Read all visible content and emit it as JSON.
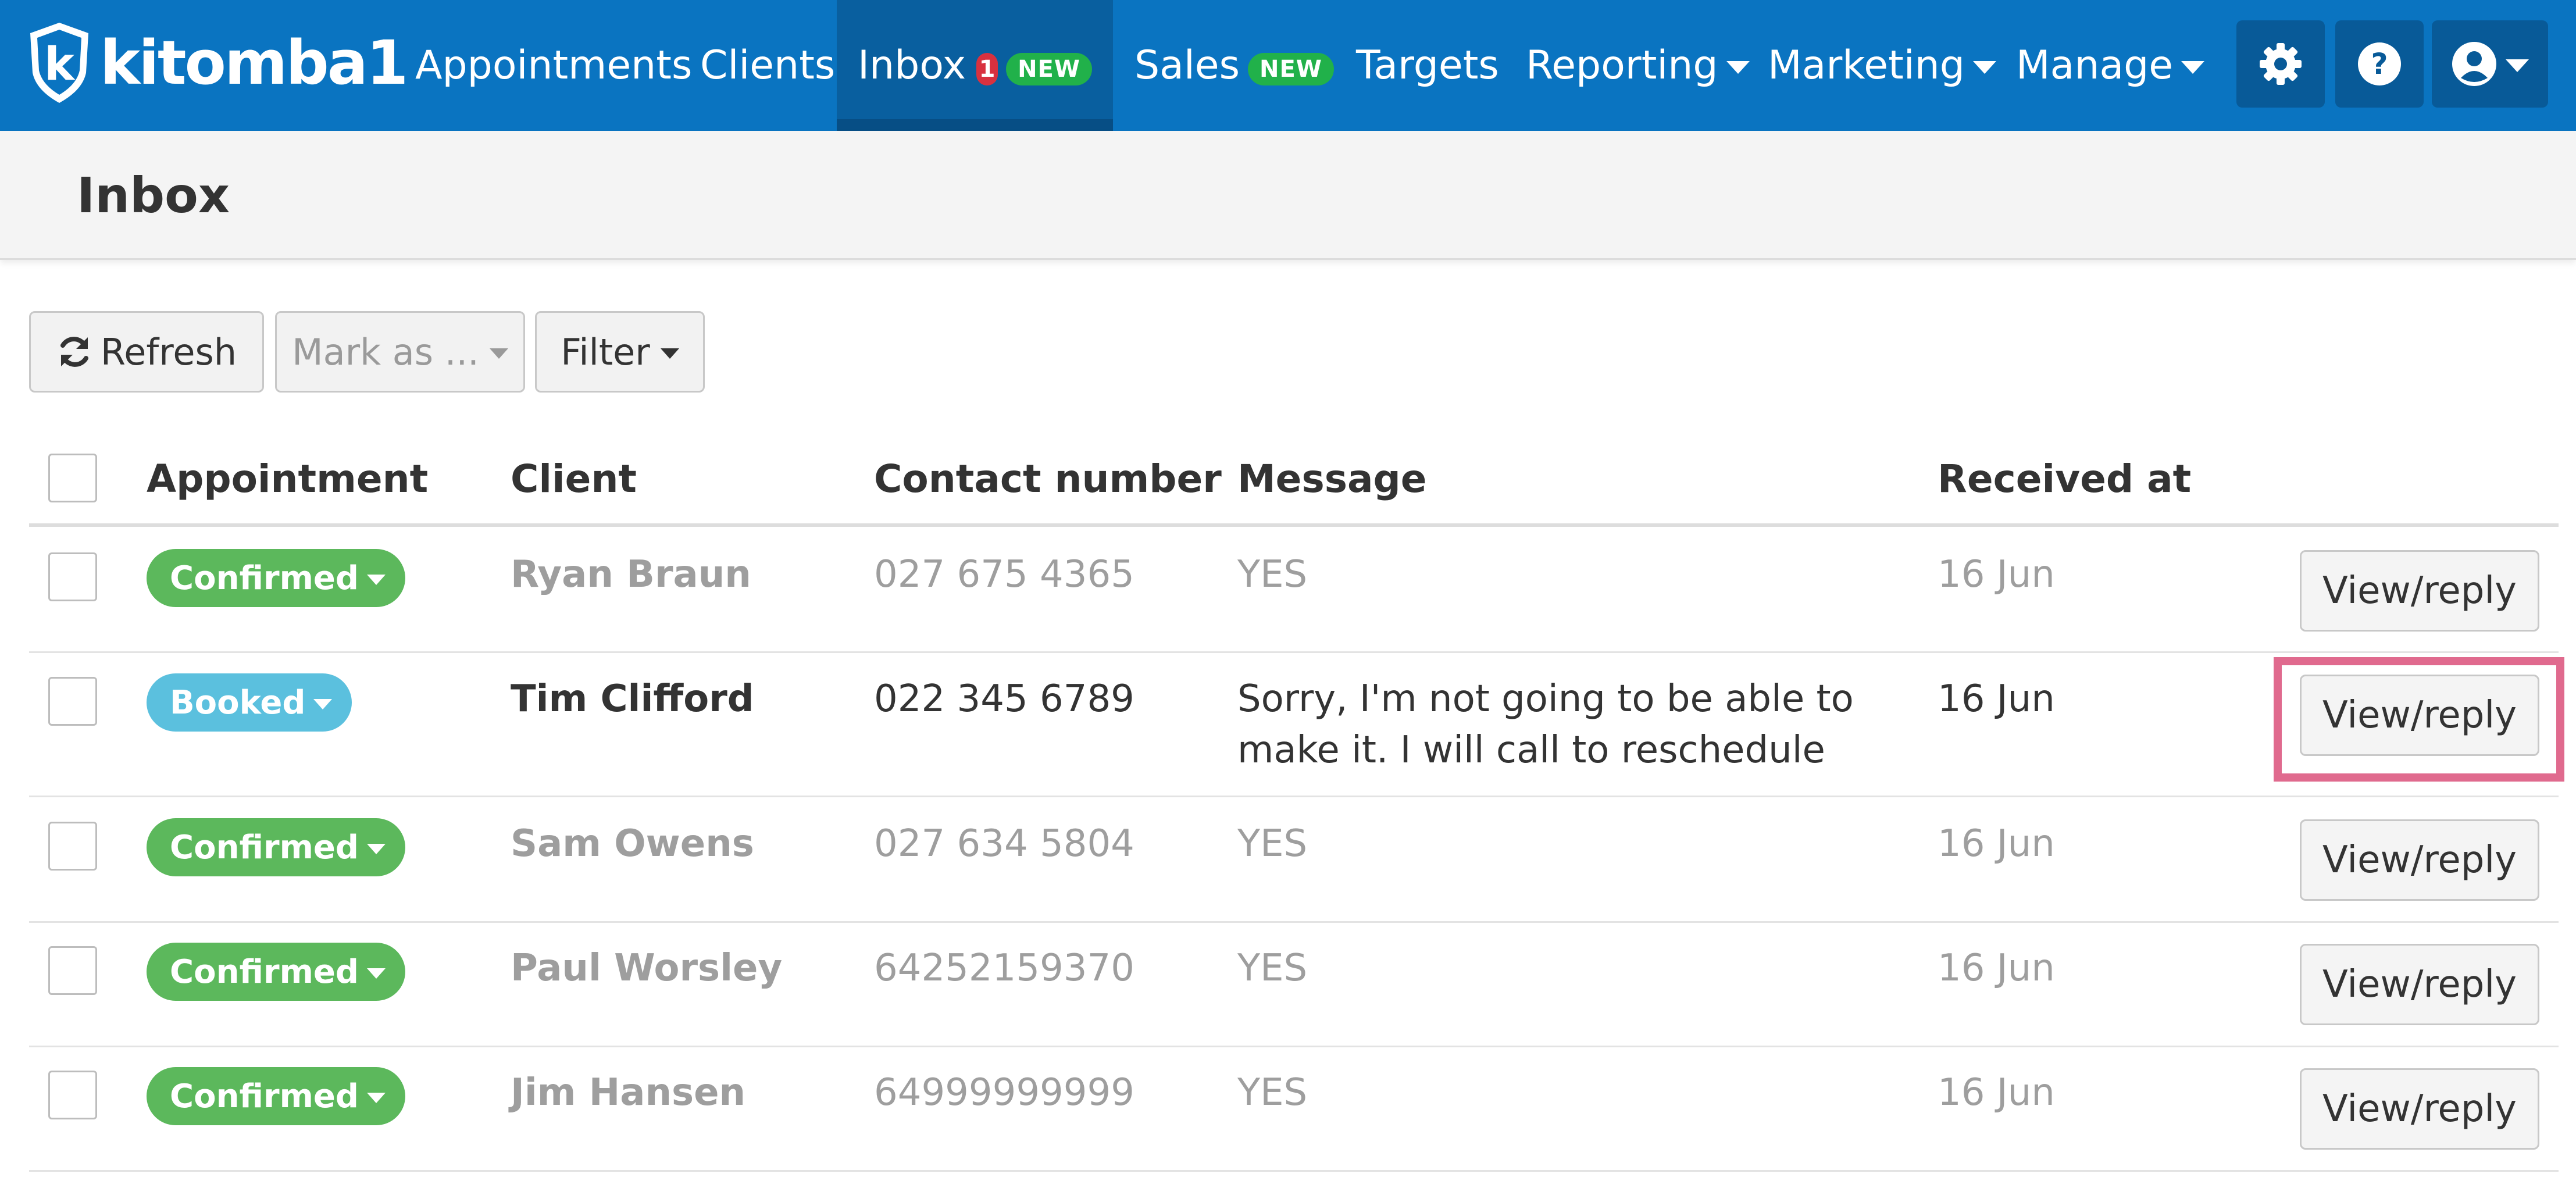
{
  "brand": {
    "name": "kitomba1",
    "logo_letter": "k"
  },
  "nav": {
    "appointments": "Appointments",
    "clients": "Clients",
    "inbox": "Inbox",
    "inbox_count": "1",
    "inbox_new": "NEW",
    "sales": "Sales",
    "sales_new": "NEW",
    "targets": "Targets",
    "reporting": "Reporting",
    "marketing": "Marketing",
    "manage": "Manage",
    "icons": [
      "gear-icon",
      "help-icon",
      "user-icon"
    ]
  },
  "page": {
    "title": "Inbox"
  },
  "toolbar": {
    "refresh": "Refresh",
    "mark_as": "Mark as ...",
    "filter": "Filter"
  },
  "table": {
    "headers": {
      "appointment": "Appointment",
      "client": "Client",
      "contact": "Contact number",
      "message": "Message",
      "received": "Received at"
    },
    "rows": [
      {
        "status": "Confirmed",
        "client": "Ryan Braun",
        "contact": "027 675 4365",
        "message": "YES",
        "received": "16 Jun",
        "action": "View/reply"
      },
      {
        "status": "Booked",
        "client": "Tim Clifford",
        "contact": "022 345 6789",
        "message": "Sorry, I'm not going to be able to make it. I will call to reschedule",
        "received": "16 Jun",
        "action": "View/reply"
      },
      {
        "status": "Confirmed",
        "client": "Sam Owens",
        "contact": "027 634 5804",
        "message": "YES",
        "received": "16 Jun",
        "action": "View/reply"
      },
      {
        "status": "Confirmed",
        "client": "Paul Worsley",
        "contact": "64252159370",
        "message": "YES",
        "received": "16 Jun",
        "action": "View/reply"
      },
      {
        "status": "Confirmed",
        "client": "Jim Hansen",
        "contact": "64999999999",
        "message": "YES",
        "received": "16 Jun",
        "action": "View/reply"
      }
    ]
  },
  "colors": {
    "nav_bg": "#0a74c1",
    "confirmed": "#5cb85c",
    "booked": "#5bc0de",
    "badge_red": "#d8313f",
    "badge_green": "#21b14a",
    "highlight": "#e06a8e"
  }
}
